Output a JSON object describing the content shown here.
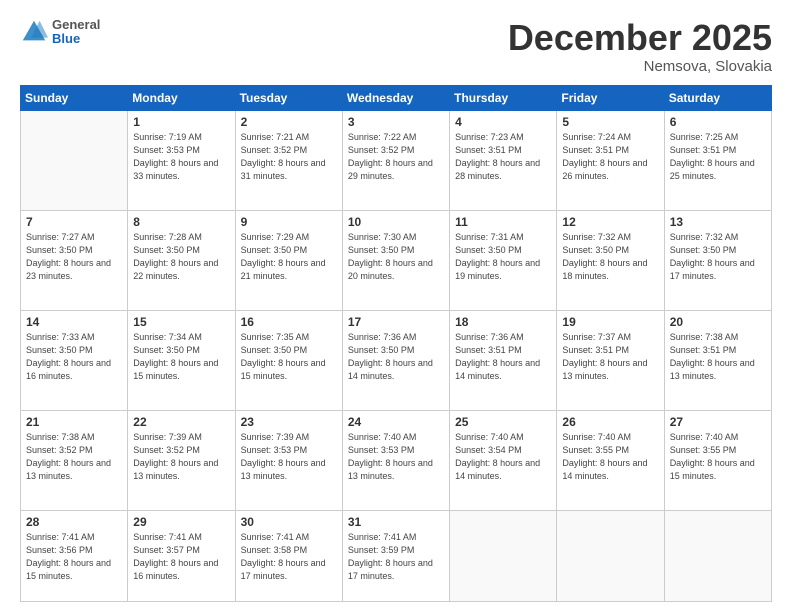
{
  "logo": {
    "general": "General",
    "blue": "Blue"
  },
  "title": {
    "month": "December 2025",
    "location": "Nemsova, Slovakia"
  },
  "weekdays": [
    "Sunday",
    "Monday",
    "Tuesday",
    "Wednesday",
    "Thursday",
    "Friday",
    "Saturday"
  ],
  "weeks": [
    [
      {
        "num": "",
        "sunrise": "",
        "sunset": "",
        "daylight": ""
      },
      {
        "num": "1",
        "sunrise": "Sunrise: 7:19 AM",
        "sunset": "Sunset: 3:53 PM",
        "daylight": "Daylight: 8 hours and 33 minutes."
      },
      {
        "num": "2",
        "sunrise": "Sunrise: 7:21 AM",
        "sunset": "Sunset: 3:52 PM",
        "daylight": "Daylight: 8 hours and 31 minutes."
      },
      {
        "num": "3",
        "sunrise": "Sunrise: 7:22 AM",
        "sunset": "Sunset: 3:52 PM",
        "daylight": "Daylight: 8 hours and 29 minutes."
      },
      {
        "num": "4",
        "sunrise": "Sunrise: 7:23 AM",
        "sunset": "Sunset: 3:51 PM",
        "daylight": "Daylight: 8 hours and 28 minutes."
      },
      {
        "num": "5",
        "sunrise": "Sunrise: 7:24 AM",
        "sunset": "Sunset: 3:51 PM",
        "daylight": "Daylight: 8 hours and 26 minutes."
      },
      {
        "num": "6",
        "sunrise": "Sunrise: 7:25 AM",
        "sunset": "Sunset: 3:51 PM",
        "daylight": "Daylight: 8 hours and 25 minutes."
      }
    ],
    [
      {
        "num": "7",
        "sunrise": "Sunrise: 7:27 AM",
        "sunset": "Sunset: 3:50 PM",
        "daylight": "Daylight: 8 hours and 23 minutes."
      },
      {
        "num": "8",
        "sunrise": "Sunrise: 7:28 AM",
        "sunset": "Sunset: 3:50 PM",
        "daylight": "Daylight: 8 hours and 22 minutes."
      },
      {
        "num": "9",
        "sunrise": "Sunrise: 7:29 AM",
        "sunset": "Sunset: 3:50 PM",
        "daylight": "Daylight: 8 hours and 21 minutes."
      },
      {
        "num": "10",
        "sunrise": "Sunrise: 7:30 AM",
        "sunset": "Sunset: 3:50 PM",
        "daylight": "Daylight: 8 hours and 20 minutes."
      },
      {
        "num": "11",
        "sunrise": "Sunrise: 7:31 AM",
        "sunset": "Sunset: 3:50 PM",
        "daylight": "Daylight: 8 hours and 19 minutes."
      },
      {
        "num": "12",
        "sunrise": "Sunrise: 7:32 AM",
        "sunset": "Sunset: 3:50 PM",
        "daylight": "Daylight: 8 hours and 18 minutes."
      },
      {
        "num": "13",
        "sunrise": "Sunrise: 7:32 AM",
        "sunset": "Sunset: 3:50 PM",
        "daylight": "Daylight: 8 hours and 17 minutes."
      }
    ],
    [
      {
        "num": "14",
        "sunrise": "Sunrise: 7:33 AM",
        "sunset": "Sunset: 3:50 PM",
        "daylight": "Daylight: 8 hours and 16 minutes."
      },
      {
        "num": "15",
        "sunrise": "Sunrise: 7:34 AM",
        "sunset": "Sunset: 3:50 PM",
        "daylight": "Daylight: 8 hours and 15 minutes."
      },
      {
        "num": "16",
        "sunrise": "Sunrise: 7:35 AM",
        "sunset": "Sunset: 3:50 PM",
        "daylight": "Daylight: 8 hours and 15 minutes."
      },
      {
        "num": "17",
        "sunrise": "Sunrise: 7:36 AM",
        "sunset": "Sunset: 3:50 PM",
        "daylight": "Daylight: 8 hours and 14 minutes."
      },
      {
        "num": "18",
        "sunrise": "Sunrise: 7:36 AM",
        "sunset": "Sunset: 3:51 PM",
        "daylight": "Daylight: 8 hours and 14 minutes."
      },
      {
        "num": "19",
        "sunrise": "Sunrise: 7:37 AM",
        "sunset": "Sunset: 3:51 PM",
        "daylight": "Daylight: 8 hours and 13 minutes."
      },
      {
        "num": "20",
        "sunrise": "Sunrise: 7:38 AM",
        "sunset": "Sunset: 3:51 PM",
        "daylight": "Daylight: 8 hours and 13 minutes."
      }
    ],
    [
      {
        "num": "21",
        "sunrise": "Sunrise: 7:38 AM",
        "sunset": "Sunset: 3:52 PM",
        "daylight": "Daylight: 8 hours and 13 minutes."
      },
      {
        "num": "22",
        "sunrise": "Sunrise: 7:39 AM",
        "sunset": "Sunset: 3:52 PM",
        "daylight": "Daylight: 8 hours and 13 minutes."
      },
      {
        "num": "23",
        "sunrise": "Sunrise: 7:39 AM",
        "sunset": "Sunset: 3:53 PM",
        "daylight": "Daylight: 8 hours and 13 minutes."
      },
      {
        "num": "24",
        "sunrise": "Sunrise: 7:40 AM",
        "sunset": "Sunset: 3:53 PM",
        "daylight": "Daylight: 8 hours and 13 minutes."
      },
      {
        "num": "25",
        "sunrise": "Sunrise: 7:40 AM",
        "sunset": "Sunset: 3:54 PM",
        "daylight": "Daylight: 8 hours and 14 minutes."
      },
      {
        "num": "26",
        "sunrise": "Sunrise: 7:40 AM",
        "sunset": "Sunset: 3:55 PM",
        "daylight": "Daylight: 8 hours and 14 minutes."
      },
      {
        "num": "27",
        "sunrise": "Sunrise: 7:40 AM",
        "sunset": "Sunset: 3:55 PM",
        "daylight": "Daylight: 8 hours and 15 minutes."
      }
    ],
    [
      {
        "num": "28",
        "sunrise": "Sunrise: 7:41 AM",
        "sunset": "Sunset: 3:56 PM",
        "daylight": "Daylight: 8 hours and 15 minutes."
      },
      {
        "num": "29",
        "sunrise": "Sunrise: 7:41 AM",
        "sunset": "Sunset: 3:57 PM",
        "daylight": "Daylight: 8 hours and 16 minutes."
      },
      {
        "num": "30",
        "sunrise": "Sunrise: 7:41 AM",
        "sunset": "Sunset: 3:58 PM",
        "daylight": "Daylight: 8 hours and 17 minutes."
      },
      {
        "num": "31",
        "sunrise": "Sunrise: 7:41 AM",
        "sunset": "Sunset: 3:59 PM",
        "daylight": "Daylight: 8 hours and 17 minutes."
      },
      {
        "num": "",
        "sunrise": "",
        "sunset": "",
        "daylight": ""
      },
      {
        "num": "",
        "sunrise": "",
        "sunset": "",
        "daylight": ""
      },
      {
        "num": "",
        "sunrise": "",
        "sunset": "",
        "daylight": ""
      }
    ]
  ]
}
